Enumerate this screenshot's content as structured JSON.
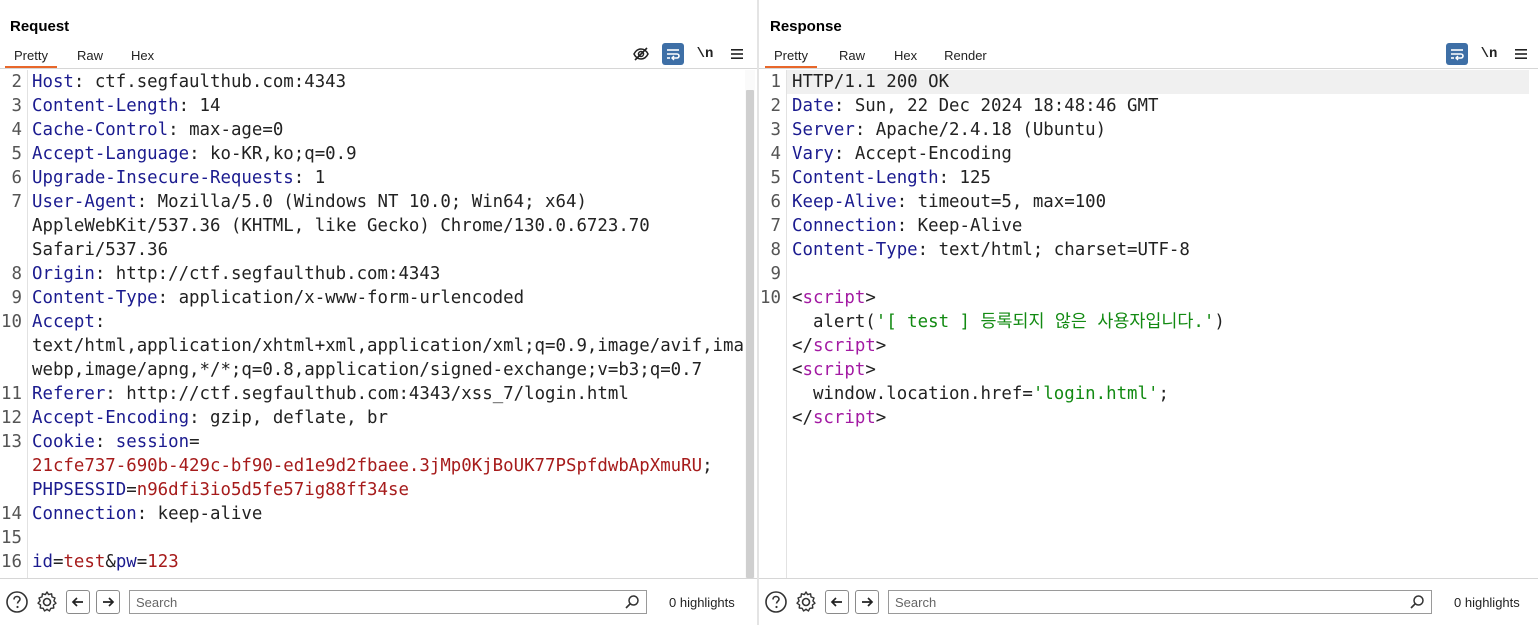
{
  "colors": {
    "accent_tab": "#e8672a",
    "tool_blue": "#3e6fa6",
    "header_key": "#1b1b8f",
    "cookie_value": "#a61b1b",
    "html_tag": "#a31aa3",
    "string": "#128a12"
  },
  "request": {
    "title": "Request",
    "tabs": [
      "Pretty",
      "Raw",
      "Hex"
    ],
    "active_tab": "Pretty",
    "tools": [
      "eye-off-icon",
      "wrap-icon",
      "\\n",
      "menu-icon"
    ],
    "newline_label": "\\n",
    "lines": [
      {
        "n": "2",
        "parts": [
          [
            "k",
            "Host"
          ],
          [
            "v",
            ": ctf.segfaulthub.com:4343"
          ]
        ]
      },
      {
        "n": "3",
        "parts": [
          [
            "k",
            "Content-Length"
          ],
          [
            "v",
            ": 14"
          ]
        ]
      },
      {
        "n": "4",
        "parts": [
          [
            "k",
            "Cache-Control"
          ],
          [
            "v",
            ": max-age=0"
          ]
        ]
      },
      {
        "n": "5",
        "parts": [
          [
            "k",
            "Accept-Language"
          ],
          [
            "v",
            ": ko-KR,ko;q=0.9"
          ]
        ]
      },
      {
        "n": "6",
        "parts": [
          [
            "k",
            "Upgrade-Insecure-Requests"
          ],
          [
            "v",
            ": 1"
          ]
        ]
      },
      {
        "n": "7",
        "parts": [
          [
            "k",
            "User-Agent"
          ],
          [
            "v",
            ": Mozilla/5.0 (Windows NT 10.0; Win64; x64)"
          ]
        ]
      },
      {
        "n": "",
        "parts": [
          [
            "v",
            "AppleWebKit/537.36 (KHTML, like Gecko) Chrome/130.0.6723.70"
          ]
        ]
      },
      {
        "n": "",
        "parts": [
          [
            "v",
            "Safari/537.36"
          ]
        ]
      },
      {
        "n": "8",
        "parts": [
          [
            "k",
            "Origin"
          ],
          [
            "v",
            ": http://ctf.segfaulthub.com:4343"
          ]
        ]
      },
      {
        "n": "9",
        "parts": [
          [
            "k",
            "Content-Type"
          ],
          [
            "v",
            ": application/x-www-form-urlencoded"
          ]
        ]
      },
      {
        "n": "10",
        "parts": [
          [
            "k",
            "Accept"
          ],
          [
            "v",
            ":"
          ]
        ]
      },
      {
        "n": "",
        "parts": [
          [
            "v",
            "text/html,application/xhtml+xml,application/xml;q=0.9,image/avif,image/"
          ]
        ]
      },
      {
        "n": "",
        "parts": [
          [
            "v",
            "webp,image/apng,*/*;q=0.8,application/signed-exchange;v=b3;q=0.7"
          ]
        ]
      },
      {
        "n": "11",
        "parts": [
          [
            "k",
            "Referer"
          ],
          [
            "v",
            ": http://ctf.segfaulthub.com:4343/xss_7/login.html"
          ]
        ]
      },
      {
        "n": "12",
        "parts": [
          [
            "k",
            "Accept-Encoding"
          ],
          [
            "v",
            ": gzip, deflate, br"
          ]
        ]
      },
      {
        "n": "13",
        "parts": [
          [
            "k",
            "Cookie"
          ],
          [
            "v",
            ": "
          ],
          [
            "ck",
            "session"
          ],
          [
            "v",
            "="
          ]
        ]
      },
      {
        "n": "",
        "parts": [
          [
            "cv",
            "21cfe737-690b-429c-bf90-ed1e9d2fbaee.3jMp0KjBoUK77PSpfdwbApXmuRU"
          ],
          [
            "v",
            ";"
          ]
        ]
      },
      {
        "n": "",
        "parts": [
          [
            "ck",
            "PHPSESSID"
          ],
          [
            "v",
            "="
          ],
          [
            "cv",
            "n96dfi3io5d5fe57ig88ff34se"
          ]
        ]
      },
      {
        "n": "14",
        "parts": [
          [
            "k",
            "Connection"
          ],
          [
            "v",
            ": keep-alive"
          ]
        ]
      },
      {
        "n": "15",
        "parts": []
      },
      {
        "n": "16",
        "parts": [
          [
            "ck",
            "id"
          ],
          [
            "v",
            "="
          ],
          [
            "cv",
            "test"
          ],
          [
            "v",
            "&"
          ],
          [
            "ck",
            "pw"
          ],
          [
            "v",
            "="
          ],
          [
            "cv",
            "123"
          ]
        ]
      }
    ],
    "search_placeholder": "Search",
    "highlights": "0 highlights"
  },
  "response": {
    "title": "Response",
    "tabs": [
      "Pretty",
      "Raw",
      "Hex",
      "Render"
    ],
    "active_tab": "Pretty",
    "newline_label": "\\n",
    "lines": [
      {
        "n": "1",
        "parts": [
          [
            "v",
            "HTTP/1.1 200 OK"
          ]
        ]
      },
      {
        "n": "2",
        "parts": [
          [
            "k",
            "Date"
          ],
          [
            "v",
            ": Sun, 22 Dec 2024 18:48:46 GMT"
          ]
        ]
      },
      {
        "n": "3",
        "parts": [
          [
            "k",
            "Server"
          ],
          [
            "v",
            ": Apache/2.4.18 (Ubuntu)"
          ]
        ]
      },
      {
        "n": "4",
        "parts": [
          [
            "k",
            "Vary"
          ],
          [
            "v",
            ": Accept-Encoding"
          ]
        ]
      },
      {
        "n": "5",
        "parts": [
          [
            "k",
            "Content-Length"
          ],
          [
            "v",
            ": 125"
          ]
        ]
      },
      {
        "n": "6",
        "parts": [
          [
            "k",
            "Keep-Alive"
          ],
          [
            "v",
            ": timeout=5, max=100"
          ]
        ]
      },
      {
        "n": "7",
        "parts": [
          [
            "k",
            "Connection"
          ],
          [
            "v",
            ": Keep-Alive"
          ]
        ]
      },
      {
        "n": "8",
        "parts": [
          [
            "k",
            "Content-Type"
          ],
          [
            "v",
            ": text/html; charset=UTF-8"
          ]
        ]
      },
      {
        "n": "9",
        "parts": []
      },
      {
        "n": "10",
        "parts": [
          [
            "v",
            "<"
          ],
          [
            "tag",
            "script"
          ],
          [
            "v",
            ">"
          ]
        ]
      },
      {
        "n": "",
        "parts": [
          [
            "v",
            "  alert("
          ],
          [
            "str",
            "'[ test ] 등록되지 않은 사용자입니다.'"
          ],
          [
            "v",
            ")"
          ]
        ]
      },
      {
        "n": "",
        "parts": [
          [
            "v",
            "</"
          ],
          [
            "tag",
            "script"
          ],
          [
            "v",
            ">"
          ]
        ]
      },
      {
        "n": "",
        "parts": [
          [
            "v",
            "<"
          ],
          [
            "tag",
            "script"
          ],
          [
            "v",
            ">"
          ]
        ]
      },
      {
        "n": "",
        "parts": [
          [
            "v",
            "  window.location.href="
          ],
          [
            "str",
            "'login.html'"
          ],
          [
            "v",
            ";"
          ]
        ]
      },
      {
        "n": "",
        "parts": [
          [
            "v",
            "</"
          ],
          [
            "tag",
            "script"
          ],
          [
            "v",
            ">"
          ]
        ]
      }
    ],
    "search_placeholder": "Search",
    "highlights": "0 highlights"
  }
}
